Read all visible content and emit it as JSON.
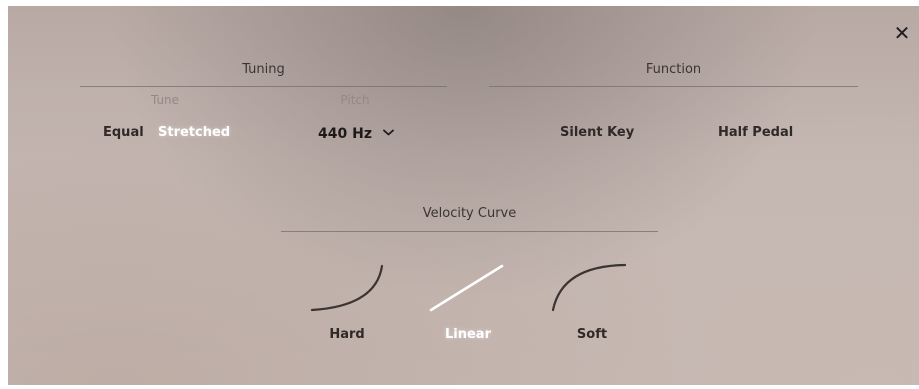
{
  "close": {
    "icon": "close-icon",
    "glyph": "✕"
  },
  "tuning": {
    "title": "Tuning",
    "tune": {
      "label": "Tune",
      "options": [
        "Equal",
        "Stretched"
      ],
      "selected": "Stretched"
    },
    "pitch": {
      "label": "Pitch",
      "value": "440 Hz",
      "icon": "chevron-down-icon"
    }
  },
  "function": {
    "title": "Function",
    "options": [
      "Silent Key",
      "Half Pedal"
    ]
  },
  "velocity_curve": {
    "title": "Velocity Curve",
    "options": [
      {
        "label": "Hard",
        "icon": "hard-curve-icon"
      },
      {
        "label": "Linear",
        "icon": "linear-curve-icon"
      },
      {
        "label": "Soft",
        "icon": "soft-curve-icon"
      }
    ],
    "selected": "Linear"
  },
  "colors": {
    "selected_text": "#ffffff",
    "unselected_text": "#2f2a28",
    "sublabel_text": "#948985"
  }
}
